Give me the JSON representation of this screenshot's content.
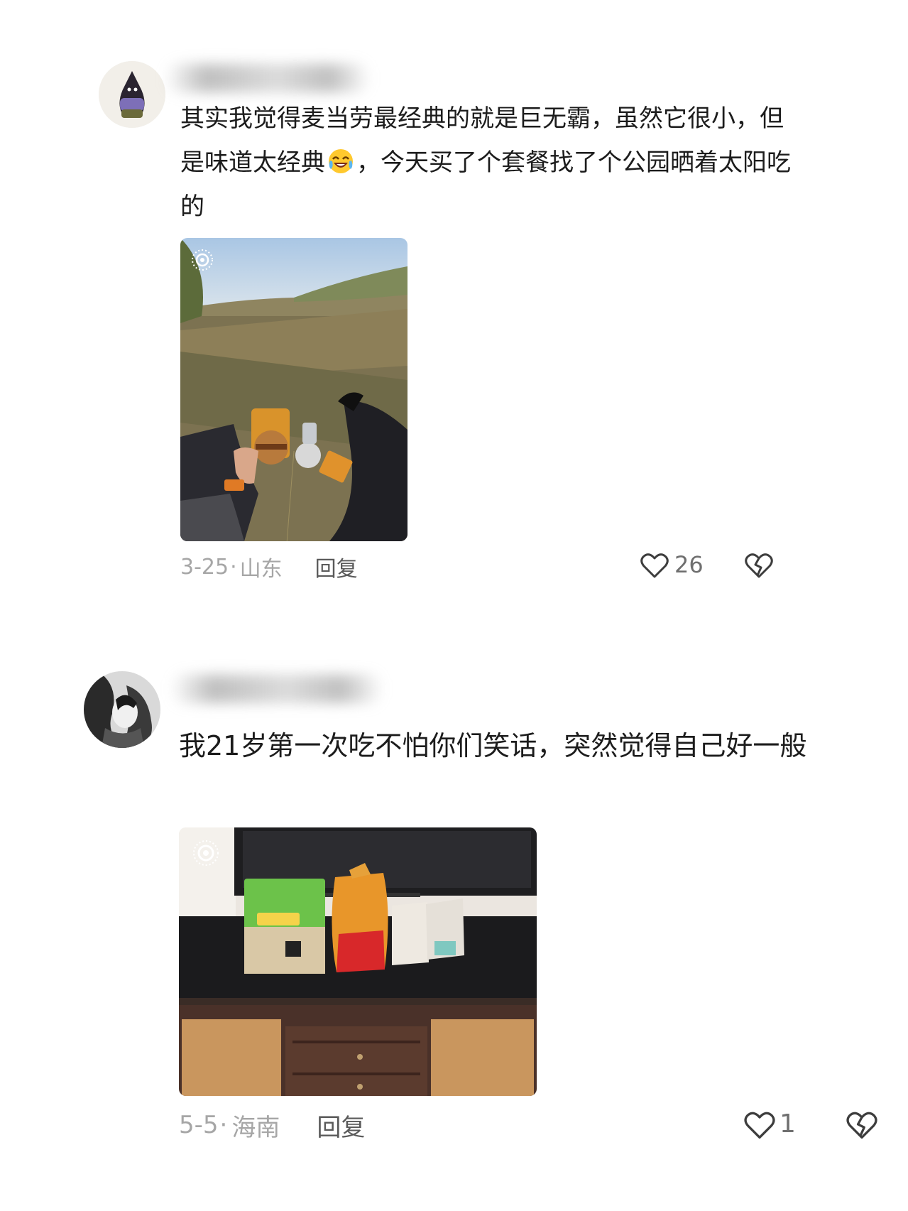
{
  "comments": [
    {
      "text_html": "其实我觉得麦当劳最经典的就是巨无霸，虽然它很小，但是味道太经典",
      "text_after_emoji": "，今天买了个套餐找了个公园晒着太阳吃的",
      "emoji": "laugh-cry",
      "date": "3-25",
      "location": "山东",
      "reply_label": "回复",
      "like_count": "26"
    },
    {
      "text": "我21岁第一次吃不怕你们笑话，突然觉得自己好一般",
      "date": "5-5",
      "location": "海南",
      "reply_label": "回复",
      "like_count": "1"
    }
  ],
  "icons": {
    "like": "heart-outline-icon",
    "dislike": "broken-heart-outline-icon",
    "photo_badge": "live-photo-icon"
  },
  "colors": {
    "text": "#1c1c1c",
    "meta": "#a6a6a6",
    "reply": "#5a5a5a"
  }
}
